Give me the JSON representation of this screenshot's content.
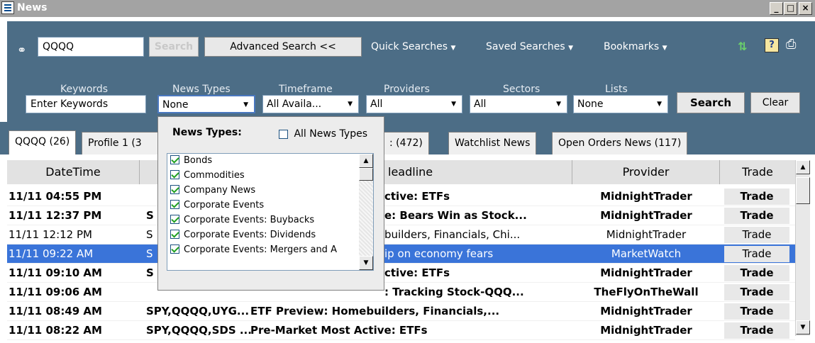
{
  "window": {
    "title": "News",
    "min_label": "_",
    "max_label": "□",
    "close_label": "×"
  },
  "toolbar": {
    "symbol_value": "QQQQ",
    "search_label": "Search",
    "advanced_label": "Advanced Search <<",
    "quick_label": "Quick Searches",
    "saved_label": "Saved Searches",
    "bookmarks_label": "Bookmarks"
  },
  "filters": {
    "keywords_label": "Keywords",
    "keywords_value": "Enter Keywords",
    "newstypes_label": "News Types",
    "newstypes_value": "None",
    "timeframe_label": "Timeframe",
    "timeframe_value": "All Availa...",
    "providers_label": "Providers",
    "providers_value": "All",
    "sectors_label": "Sectors",
    "sectors_value": "All",
    "lists_label": "Lists",
    "lists_value": "None",
    "search_label": "Search",
    "clear_label": "Clear"
  },
  "tabs": [
    {
      "label": "QQQQ (26)"
    },
    {
      "label": "Profile 1 (3"
    },
    {
      "label": ": (472)"
    },
    {
      "label": "Watchlist News"
    },
    {
      "label": "Open Orders News (117)"
    }
  ],
  "table": {
    "headers": {
      "datetime": "DateTime",
      "headline": "leadline",
      "provider": "Provider",
      "trade": "Trade"
    },
    "rows": [
      {
        "datetime": "11/11 04:55 PM",
        "symbols": "",
        "headline": "ctive: ETFs",
        "provider": "MidnightTrader",
        "trade": "Trade"
      },
      {
        "datetime": "11/11 12:37 PM",
        "symbols": "S",
        "headline": "e: Bears Win as Stock...",
        "provider": "MidnightTrader",
        "trade": "Trade"
      },
      {
        "datetime": "11/11 12:12 PM",
        "symbols": "S",
        "headline": "builders, Financials, Chi...",
        "provider": "MidnightTrader",
        "trade": "Trade"
      },
      {
        "datetime": "11/11 09:22 AM",
        "symbols": "S",
        "headline": "ip on economy fears",
        "provider": "MarketWatch",
        "trade": "Trade"
      },
      {
        "datetime": "11/11 09:10 AM",
        "symbols": "S",
        "headline": "ctive: ETFs",
        "provider": "MidnightTrader",
        "trade": "Trade"
      },
      {
        "datetime": "11/11 09:06 AM",
        "symbols": "",
        "headline": ": Tracking Stock-QQQ...",
        "provider": "TheFlyOnTheWall",
        "trade": "Trade"
      },
      {
        "datetime": "11/11 08:49 AM",
        "symbols": "SPY,QQQQ,UYG...",
        "headline": "ETF Preview: Homebuilders, Financials,...",
        "provider": "MidnightTrader",
        "trade": "Trade"
      },
      {
        "datetime": "11/11 08:22 AM",
        "symbols": "SPY,QQQQ,SDS ...",
        "headline": "Pre-Market Most Active: ETFs",
        "provider": "MidnightTrader",
        "trade": "Trade"
      }
    ]
  },
  "popup": {
    "title": "News Types:",
    "all_label": "All News Types",
    "all_checked": false,
    "items": [
      {
        "label": "Bonds",
        "checked": true
      },
      {
        "label": "Commodities",
        "checked": true
      },
      {
        "label": "Company News",
        "checked": true
      },
      {
        "label": "Corporate Events",
        "checked": true
      },
      {
        "label": "Corporate Events: Buybacks",
        "checked": true
      },
      {
        "label": "Corporate Events: Dividends",
        "checked": true
      },
      {
        "label": "Corporate Events: Mergers and A",
        "checked": true
      }
    ]
  },
  "colors": {
    "toolbar_bg": "#4c6d86",
    "selected_row": "#3a74d9",
    "titlebar_bg": "#a3a3a3"
  }
}
